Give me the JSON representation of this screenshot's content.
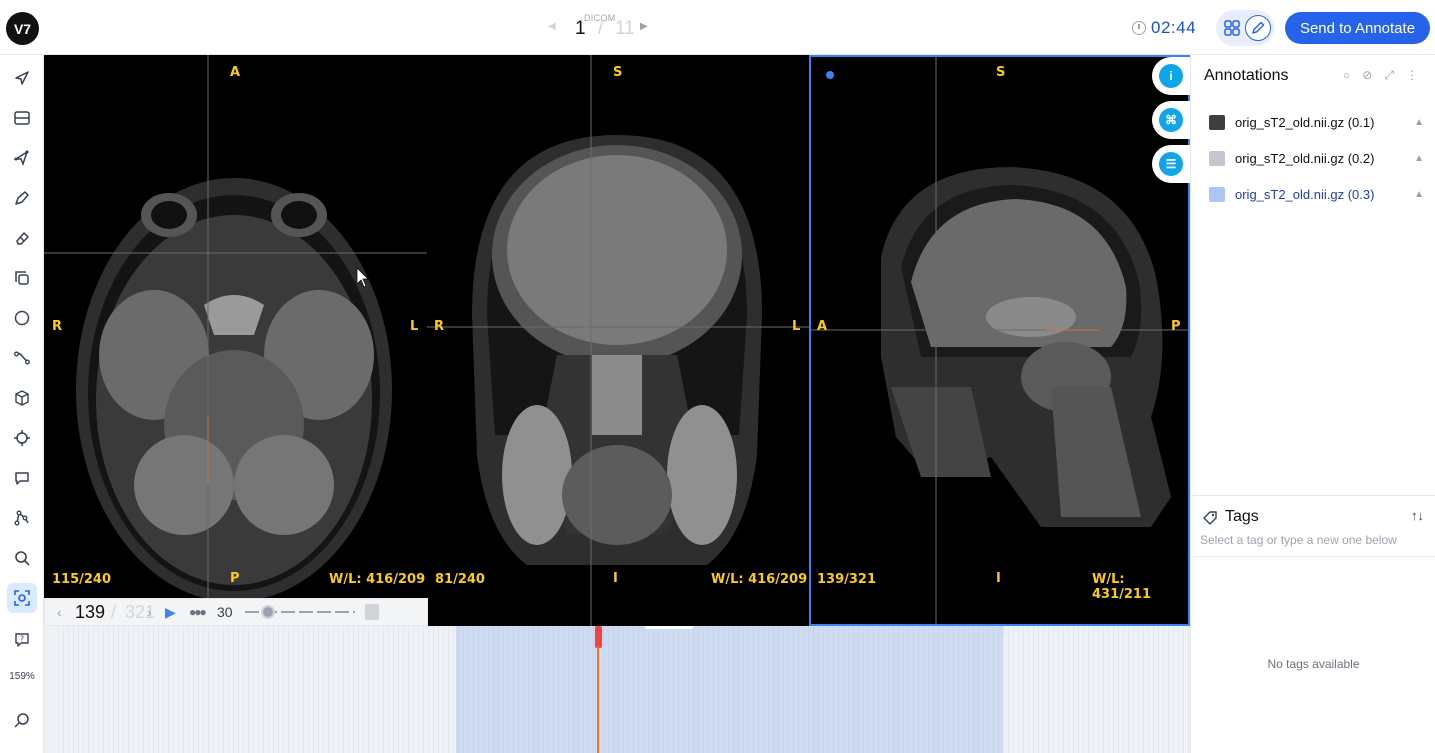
{
  "app": {
    "logo_text": "V7"
  },
  "header": {
    "pager": {
      "current": "1",
      "separator": "/",
      "total": "11",
      "format_tag": "DICOM"
    },
    "timer": "02:44",
    "send_button": "Send to Annotate"
  },
  "tools": {
    "zoom_level": "159%",
    "items": [
      "navigate-icon",
      "layout-icon",
      "polygon-tool-icon",
      "brush-icon",
      "eraser-icon",
      "clone-icon",
      "ellipse-icon",
      "line-tool-icon",
      "cuboid-icon",
      "keypoint-icon",
      "comment-icon",
      "skeleton-icon",
      "search-icon",
      "selection-icon",
      "help-icon",
      "zoom-icon"
    ]
  },
  "viewer": {
    "panes": [
      {
        "name": "axial",
        "top": "A",
        "bottom": "P",
        "left": "R",
        "right": "L",
        "slice": "115/240",
        "wl": "W/L: 416/209"
      },
      {
        "name": "coronal",
        "top": "S",
        "bottom": "I",
        "left": "R",
        "right": "L",
        "slice": "81/240",
        "wl": "W/L: 416/209"
      },
      {
        "name": "sagittal",
        "top": "S",
        "bottom": "I",
        "left": "A",
        "right": "P",
        "slice": "139/321",
        "wl": "W/L: 431/211"
      }
    ]
  },
  "frame_controls": {
    "current": "139",
    "separator": "/",
    "total": "321",
    "fps": "30"
  },
  "timeline": {
    "playhead_frame": 139,
    "total_frames": 321
  },
  "panel": {
    "title": "Annotations",
    "annotations": [
      {
        "label": "orig_sT2_old.nii.gz (0.1)",
        "color": "#3f3f3f"
      },
      {
        "label": "orig_sT2_old.nii.gz (0.2)",
        "color": "#c4c7cf"
      },
      {
        "label": "orig_sT2_old.nii.gz (0.3)",
        "color": "#a9c7f2"
      }
    ],
    "tags": {
      "title": "Tags",
      "hint": "Select a tag or type a new one below",
      "empty": "No tags available"
    }
  },
  "colors": {
    "accent": "#2563eb",
    "overlay_text": "#facc15"
  }
}
